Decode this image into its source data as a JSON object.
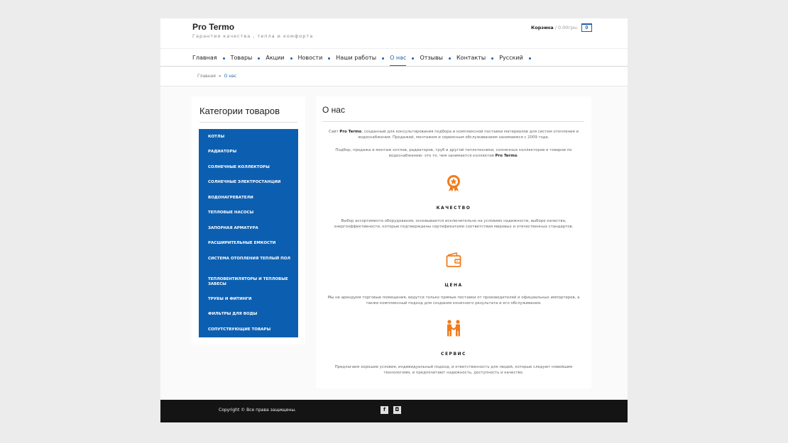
{
  "site": {
    "title": "Pro Termo",
    "tagline": "Гарантия качества , тепла и комфорта"
  },
  "cart": {
    "label": "Корзина",
    "amount": " / 0.00грн.",
    "count": "0"
  },
  "nav": [
    {
      "label": "Главная"
    },
    {
      "label": "Товары"
    },
    {
      "label": "Акции"
    },
    {
      "label": "Новости"
    },
    {
      "label": "Наши работы"
    },
    {
      "label": "О нас",
      "active": true
    },
    {
      "label": "Отзывы"
    },
    {
      "label": "Контакты"
    },
    {
      "label": "Русский"
    }
  ],
  "breadcrumb": {
    "home": "Главная",
    "separator": "»",
    "current": "О нас"
  },
  "sidebar": {
    "title": "Категории товаров",
    "categories": [
      "Котлы",
      "Радиаторы",
      "Солнечные коллекторы",
      "Солнечные электростанции",
      "Водонагреватели",
      "Тепловые насосы",
      "Запорная арматура",
      "Расширительные емкости",
      "Система отопления теплый пол",
      "Тепловентиляторы и тепловые завесы",
      "Трубы и фитинги",
      "Фильтры для воды",
      "Сопутствующие товары"
    ]
  },
  "main": {
    "title": "О нас",
    "intro1_pre": "Сайт ",
    "intro1_brand": "Pro Termo",
    "intro1_post": ", созданный для консультирования подбора и комплексной поставки материалов для систем отопления и водоснабжения. Продажей, монтажем и сервисным обслуживанием занимаемся с 2009 года.",
    "intro2_pre": "Подбор, продажа и монтаж котлов, радиаторов, труб и другой теплотехники, солнечных коллекторов и товаров по водоснабжению- это то, чем занимается коллектив ",
    "intro2_brand": "Pro Termo",
    "intro2_post": ".",
    "features": [
      {
        "icon": "award-medal-icon",
        "title": "КАЧЕСТВО",
        "text": "Выбор ассортимента оборудования, основывается исключительно на условиях надежности, выборе качества, энергоэффективности, которые подтверждены сертификатами соответствия мировых и отечественных стандартов."
      },
      {
        "icon": "wallet-icon",
        "title": "ЦЕНА",
        "text": "Мы не арендуем торговые помещения, ведутся только прямые поставки от производителей и официальных импортеров, а также комплексный подход для создания конечного результата и его обслуживания."
      },
      {
        "icon": "handshake-icon",
        "title": "СЕРВИС",
        "text": "Предлагаем хорошие условия, индивидуальный подход, и ответственность для людей, которые следуют новейшим технологиям, и предпочитают надежность, доступность и качество."
      }
    ]
  },
  "footer": {
    "copyright": "Copyright © Все права защищены.",
    "social": [
      {
        "icon": "facebook-icon",
        "glyph": "f"
      },
      {
        "icon": "instagram-icon",
        "glyph": "◘"
      }
    ]
  },
  "colors": {
    "accent": "#1e5fa8",
    "sidebar_bg": "#0c5fb0",
    "icon_orange": "#f07c1c",
    "footer_bg": "#141414"
  }
}
